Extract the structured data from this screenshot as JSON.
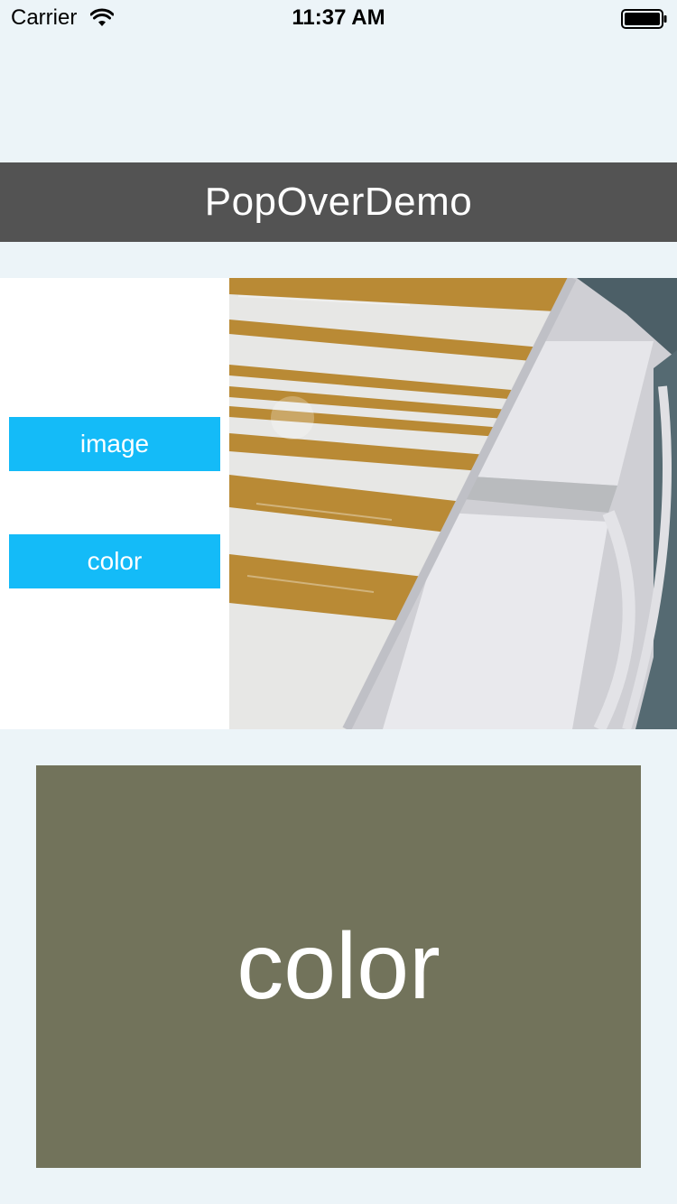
{
  "status_bar": {
    "carrier": "Carrier",
    "time": "11:37 AM",
    "wifi_icon": "wifi-icon",
    "battery_icon": "battery-icon"
  },
  "nav": {
    "title": "PopOverDemo"
  },
  "buttons": {
    "image_label": "image",
    "color_label": "color"
  },
  "photo": {
    "description_icon": "photo-of-striped-wooden-bench"
  },
  "color_box": {
    "label": "color",
    "color": "#72735b"
  },
  "colors": {
    "background": "#ecf4f8",
    "title_bar": "#535353",
    "button": "#14bbf8",
    "color_box": "#72735b"
  }
}
